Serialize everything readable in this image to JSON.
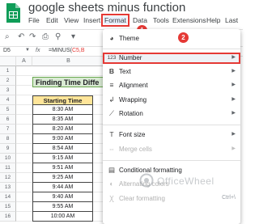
{
  "app": {
    "title": "google sheets minus function",
    "brand_color": "#0f9d58"
  },
  "menu": {
    "items": [
      "File",
      "Edit",
      "View",
      "Insert",
      "Format",
      "Data",
      "Tools",
      "Extensions",
      "Help"
    ],
    "active": "Format",
    "overflow": "Last"
  },
  "badges": [
    "1",
    "2"
  ],
  "formula_bar": {
    "cell_ref": "D5",
    "fx": "fx",
    "formula_prefix": "=MINUS(",
    "formula_highlight": "C5,B",
    "formula_suffix": ""
  },
  "grid": {
    "columns": [
      "A",
      "B"
    ],
    "rows": [
      "1",
      "2",
      "3",
      "4",
      "5",
      "6",
      "7",
      "8",
      "9",
      "10",
      "11",
      "12",
      "13",
      "14",
      "15",
      "16"
    ],
    "banner": "Finding Time Diffe",
    "header": "Starting Time",
    "times": [
      "8:30 AM",
      "8:35 AM",
      "8:20 AM",
      "9:00 AM",
      "8:54 AM",
      "9:15 AM",
      "9:51 AM",
      "9:25 AM",
      "9:44 AM",
      "9:40 AM",
      "9:55 AM",
      "10:00 AM"
    ]
  },
  "format_menu": {
    "items": [
      {
        "label": "Theme",
        "icon": "palette-icon",
        "glyph": "◕"
      },
      {
        "label": "Number",
        "icon": "number-format-icon",
        "glyph": "123",
        "submenu": true,
        "highlighted": true
      },
      {
        "label": "Text",
        "icon": "bold-icon",
        "glyph": "B",
        "submenu": true
      },
      {
        "label": "Alignment",
        "icon": "align-icon",
        "glyph": "≡",
        "submenu": true
      },
      {
        "label": "Wrapping",
        "icon": "wrap-icon",
        "glyph": "↲",
        "submenu": true
      },
      {
        "label": "Rotation",
        "icon": "rotation-icon",
        "glyph": "⟋",
        "submenu": true
      },
      {
        "label": "Font size",
        "icon": "font-size-icon",
        "glyph": "T",
        "submenu": true
      },
      {
        "label": "Merge cells",
        "icon": "merge-icon",
        "glyph": "⇔",
        "submenu": true,
        "disabled": true
      },
      {
        "label": "Conditional formatting",
        "icon": "conditional-format-icon",
        "glyph": "▤"
      },
      {
        "label": "Alternating colors",
        "icon": "alternating-colors-icon",
        "glyph": "◐",
        "disabled": true
      },
      {
        "label": "Clear formatting",
        "icon": "clear-format-icon",
        "glyph": "Ꭓ",
        "shortcut": "Ctrl+\\",
        "disabled": true
      }
    ]
  },
  "watermark": {
    "text": "OfficeWheel"
  },
  "colors": {
    "highlight_red": "#e53935",
    "banner_green": "#d9ead3",
    "header_yellow": "#ffe599"
  }
}
